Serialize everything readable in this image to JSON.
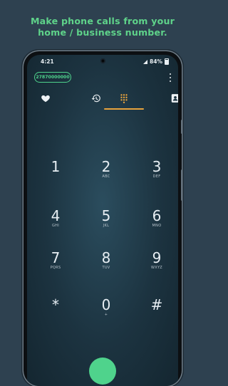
{
  "headline": {
    "line1": "Make phone calls from your",
    "line2": "home / business number."
  },
  "statusbar": {
    "time": "4:21",
    "battery": "84%"
  },
  "account": {
    "number": "27870000000"
  },
  "tabs": [
    {
      "name": "favorites",
      "icon": "heart-icon"
    },
    {
      "name": "recents",
      "icon": "history-icon"
    },
    {
      "name": "dialpad",
      "icon": "dialpad-icon",
      "active": true
    },
    {
      "name": "contacts",
      "icon": "contact-icon"
    }
  ],
  "keypad": {
    "keys": [
      {
        "digit": "1",
        "letters": ""
      },
      {
        "digit": "2",
        "letters": "ABC"
      },
      {
        "digit": "3",
        "letters": "DEF"
      },
      {
        "digit": "4",
        "letters": "GHI"
      },
      {
        "digit": "5",
        "letters": "JKL"
      },
      {
        "digit": "6",
        "letters": "MNO"
      },
      {
        "digit": "7",
        "letters": "PQRS"
      },
      {
        "digit": "8",
        "letters": "TUV"
      },
      {
        "digit": "9",
        "letters": "WXYZ"
      },
      {
        "digit": "*",
        "letters": ""
      },
      {
        "digit": "0",
        "letters": "+"
      },
      {
        "digit": "#",
        "letters": ""
      }
    ]
  },
  "colors": {
    "background": "#2e4150",
    "accent_green": "#4fd38c",
    "headline_green": "#5fd38a",
    "tab_active": "#e8a33d"
  }
}
